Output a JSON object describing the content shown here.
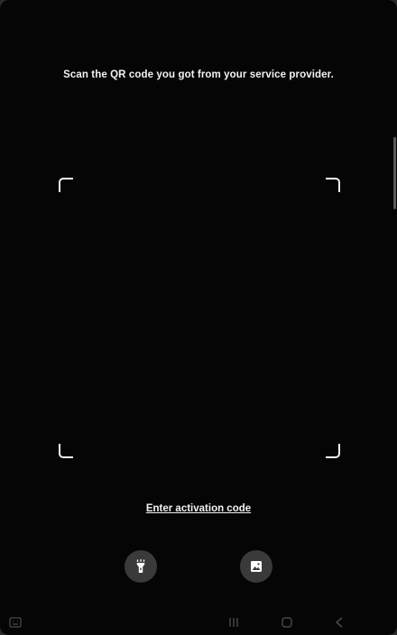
{
  "scanner": {
    "instruction": "Scan the QR code you got from your service provider.",
    "activation_link": "Enter activation code"
  },
  "buttons": {
    "flashlight_icon": "flashlight-icon",
    "gallery_icon": "gallery-icon"
  },
  "navbar": {
    "icons": [
      "keyboard-icon",
      "recents-icon",
      "home-icon",
      "back-icon"
    ]
  },
  "colors": {
    "background": "#050505",
    "text": "#f2f2f2",
    "button_bg": "#3a3a3a",
    "nav_icon": "#4a4a4a"
  }
}
